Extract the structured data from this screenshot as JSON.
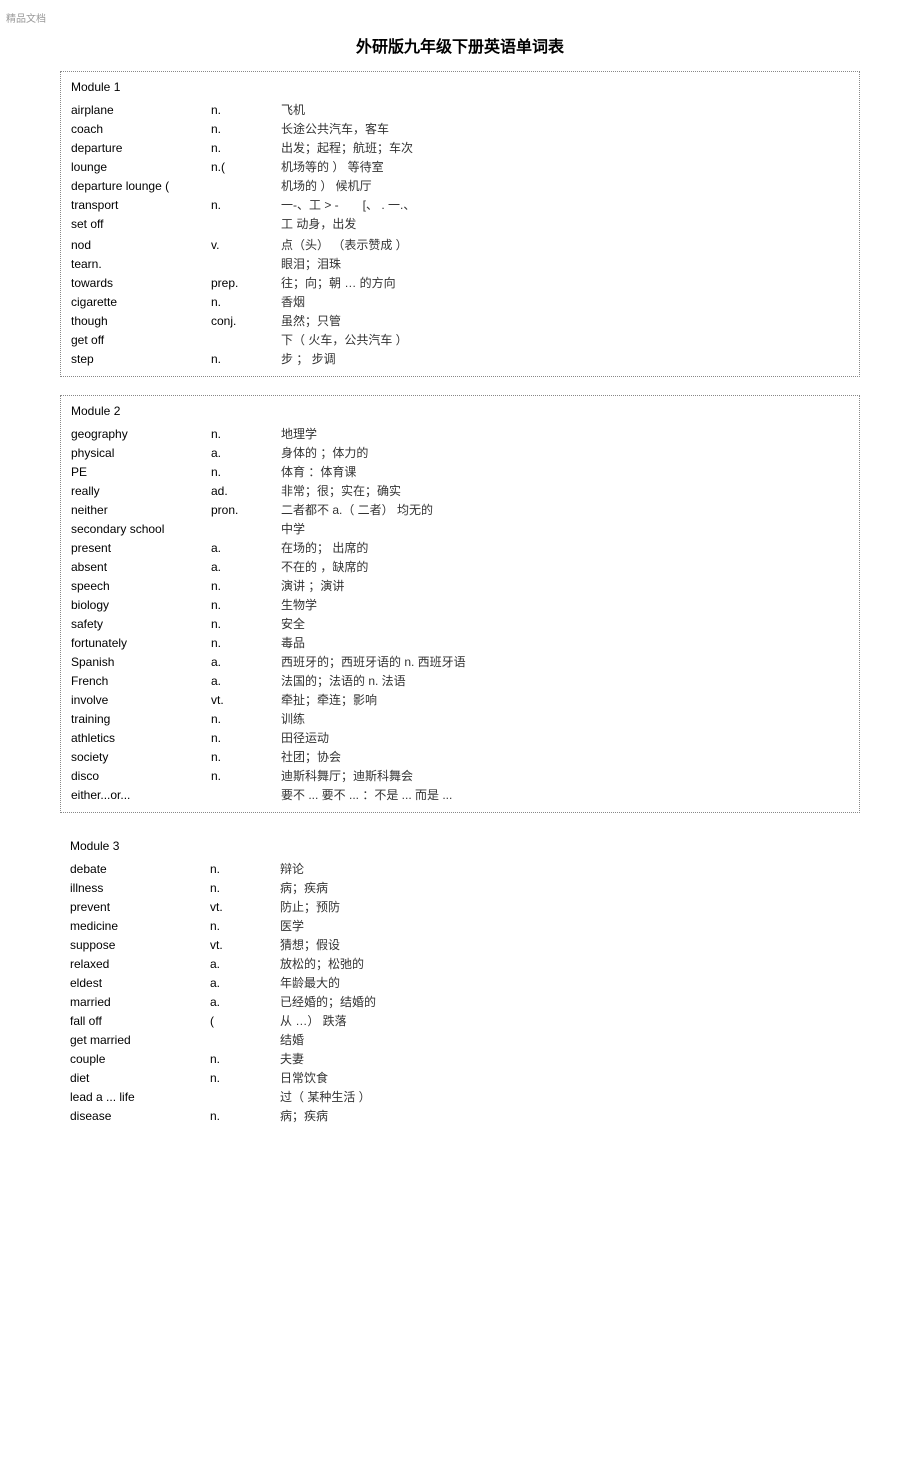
{
  "watermark": "精品文档",
  "title": "外研版九年级下册英语单词表",
  "modules": [
    {
      "name": "Module 1",
      "border": true,
      "entries": [
        {
          "word": "airplane",
          "pos": "n.",
          "cn": "飞机"
        },
        {
          "word": "coach",
          "pos": "n.",
          "cn": "长途公共汽车，客车"
        },
        {
          "word": "departure",
          "pos": "n.",
          "cn": "出发；起程；航班；车次"
        },
        {
          "word": "lounge",
          "pos": "n.(",
          "cn": "机场等的 ） 等待室"
        },
        {
          "word": "departure lounge (",
          "pos": "",
          "cn": "机场的 ） 候机厅"
        },
        {
          "word": "transport",
          "pos": "n.",
          "cn": "一-、工 > -　　[、 . 一.、"
        },
        {
          "word": "set off",
          "pos": "",
          "cn": "工 动身，出发"
        },
        {
          "word": "",
          "pos": "",
          "cn": ""
        },
        {
          "word": "nod",
          "pos": "v.",
          "cn": "点（头） （表示赞成 ）"
        },
        {
          "word": "tearn.",
          "pos": "",
          "cn": "眼泪；泪珠"
        },
        {
          "word": "towards",
          "pos": "prep.",
          "cn": "往；向；朝  …   的方向"
        },
        {
          "word": "cigarette",
          "pos": "n.",
          "cn": "香烟"
        },
        {
          "word": "though",
          "pos": "conj.",
          "cn": "虽然；只管"
        },
        {
          "word": "get off",
          "pos": "",
          "cn": "下（ 火车，公共汽车  ）"
        },
        {
          "word": "step",
          "pos": "n.",
          "cn": "步 ； 步调"
        }
      ]
    },
    {
      "name": "Module 2",
      "border": true,
      "entries": [
        {
          "word": "geography",
          "pos": "n.",
          "cn": "地理学"
        },
        {
          "word": "physical",
          "pos": "a.",
          "cn": "身体的 ；体力的"
        },
        {
          "word": "PE",
          "pos": "n.",
          "cn": "体育 ：体育课"
        },
        {
          "word": "really",
          "pos": "ad.",
          "cn": "非常；很；实在；确实"
        },
        {
          "word": "neither",
          "pos": "pron.",
          "cn": "二者都不 a.（ 二者） 均无的"
        },
        {
          "word": "secondary school",
          "pos": "",
          "cn": "中学"
        },
        {
          "word": "present",
          "pos": "a.",
          "cn": "在场的；  出席的"
        },
        {
          "word": "absent",
          "pos": "a.",
          "cn": "不在的 ，缺席的"
        },
        {
          "word": "speech",
          "pos": "n.",
          "cn": "演讲 ；演讲"
        },
        {
          "word": "biology",
          "pos": "n.",
          "cn": "生物学"
        },
        {
          "word": "safety",
          "pos": "n.",
          "cn": "安全"
        },
        {
          "word": "fortunately",
          "pos": "n.",
          "cn": "毒品"
        },
        {
          "word": "Spanish",
          "pos": "a.",
          "cn": "西班牙的；西班牙语的  n. 西班牙语"
        },
        {
          "word": "French",
          "pos": "a.",
          "cn": "法国的；法语的  n. 法语"
        },
        {
          "word": "involve",
          "pos": "vt.",
          "cn": "牵扯；牵连；影响"
        },
        {
          "word": "training",
          "pos": "n.",
          "cn": "训练"
        },
        {
          "word": "athletics",
          "pos": "n.",
          "cn": "田径运动"
        },
        {
          "word": "society",
          "pos": "n.",
          "cn": "社团；协会"
        },
        {
          "word": "disco",
          "pos": "n.",
          "cn": "迪斯科舞厅；迪斯科舞会"
        },
        {
          "word": "either...or...",
          "pos": "",
          "cn": "要不  ... 要不  ... ：不是  ... 而是  ..."
        }
      ]
    },
    {
      "name": "Module 3",
      "border": false,
      "entries": [
        {
          "word": "debate",
          "pos": "n.",
          "cn": "辩论"
        },
        {
          "word": "illness",
          "pos": "n.",
          "cn": "病；疾病"
        },
        {
          "word": "prevent",
          "pos": "vt.",
          "cn": "防止；预防"
        },
        {
          "word": "medicine",
          "pos": "n.",
          "cn": "医学"
        },
        {
          "word": "suppose",
          "pos": "vt.",
          "cn": "猜想；假设"
        },
        {
          "word": "relaxed",
          "pos": "a.",
          "cn": "放松的；松弛的"
        },
        {
          "word": "eldest",
          "pos": "a.",
          "cn": "年龄最大的"
        },
        {
          "word": "married",
          "pos": "a.",
          "cn": "已经婚的；结婚的"
        },
        {
          "word": "fall off",
          "pos": "(",
          "cn": "从  …） 跌落"
        },
        {
          "word": "get married",
          "pos": "",
          "cn": "结婚"
        },
        {
          "word": "couple",
          "pos": "n.",
          "cn": "夫妻"
        },
        {
          "word": "diet",
          "pos": "n.",
          "cn": "日常饮食"
        },
        {
          "word": "lead a ... life",
          "pos": "",
          "cn": "过（ 某种生活  ）"
        },
        {
          "word": "disease",
          "pos": "n.",
          "cn": "病；疾病"
        }
      ]
    }
  ]
}
